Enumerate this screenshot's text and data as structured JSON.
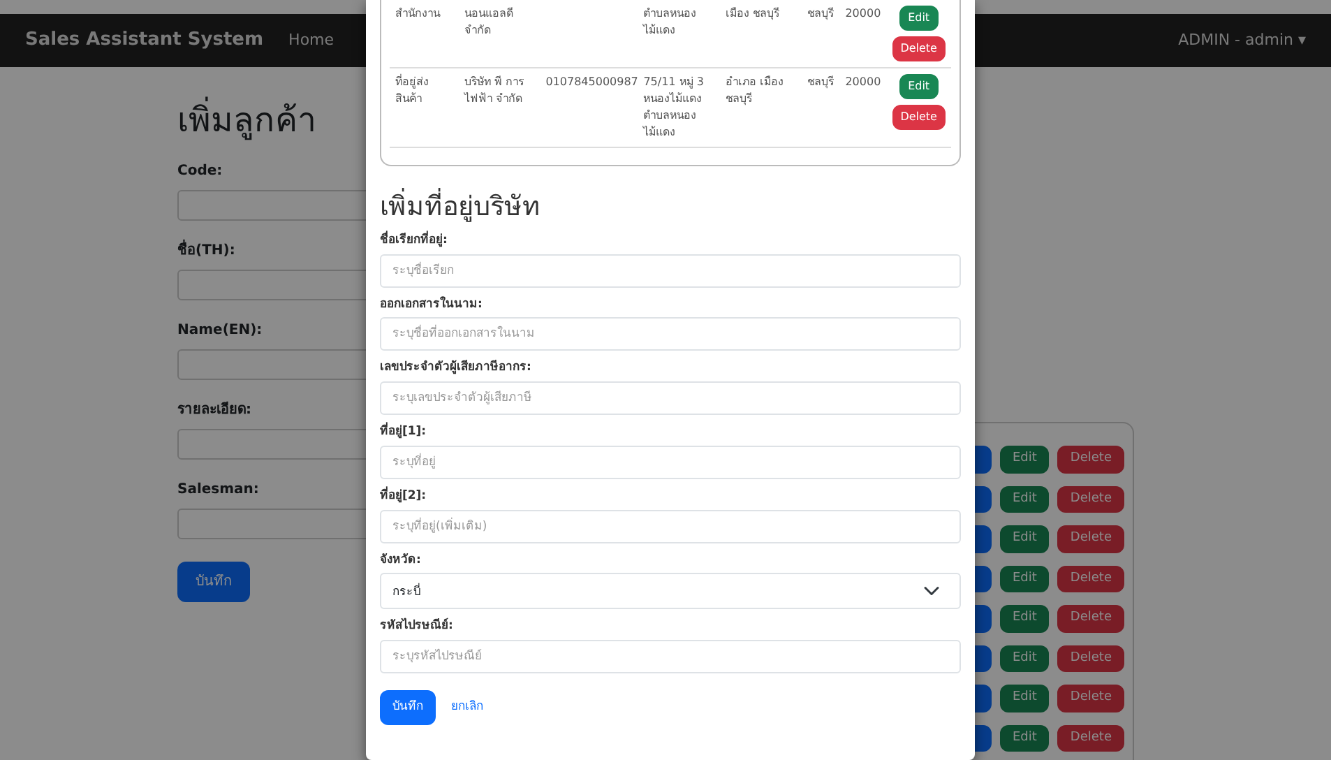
{
  "navbar": {
    "brand": "Sales Assistant System",
    "links": [
      "Home"
    ],
    "user": "ADMIN - admin ▾"
  },
  "customer_form": {
    "title": "เพิ่มลูกค้า",
    "fields": [
      {
        "label": "Code:"
      },
      {
        "label": "ชื่อ(TH):"
      },
      {
        "label": "Name(EN):"
      },
      {
        "label": "รายละเอียด:"
      },
      {
        "label": "Salesman:"
      }
    ],
    "submit": "บันทึก"
  },
  "customer_list": {
    "rows": [
      {
        "buttons": [
          {
            "kind": "primary"
          },
          {
            "kind": "edit",
            "label": "Edit"
          },
          {
            "kind": "delete",
            "label": "Delete"
          }
        ]
      },
      {
        "buttons": [
          {
            "kind": "primary"
          },
          {
            "kind": "edit",
            "label": "Edit"
          },
          {
            "kind": "delete",
            "label": "Delete"
          }
        ]
      },
      {
        "buttons": [
          {
            "kind": "primary"
          },
          {
            "kind": "edit",
            "label": "Edit"
          },
          {
            "kind": "delete",
            "label": "Delete"
          }
        ]
      },
      {
        "buttons": [
          {
            "kind": "primary"
          },
          {
            "kind": "edit",
            "label": "Edit"
          },
          {
            "kind": "delete",
            "label": "Delete"
          }
        ]
      },
      {
        "buttons": [
          {
            "kind": "primary"
          },
          {
            "kind": "edit",
            "label": "Edit"
          },
          {
            "kind": "delete",
            "label": "Delete"
          }
        ]
      },
      {
        "buttons": [
          {
            "kind": "primary"
          },
          {
            "kind": "edit",
            "label": "Edit"
          },
          {
            "kind": "delete",
            "label": "Delete"
          }
        ]
      },
      {
        "buttons": [
          {
            "kind": "primary"
          },
          {
            "kind": "edit",
            "label": "Edit"
          },
          {
            "kind": "delete",
            "label": "Delete"
          }
        ]
      },
      {
        "buttons": [
          {
            "kind": "primary"
          },
          {
            "kind": "edit",
            "label": "Edit"
          },
          {
            "kind": "delete",
            "label": "Delete"
          }
        ]
      }
    ]
  },
  "modal": {
    "address_table": {
      "rows": [
        {
          "cells": [
            "สำนักงาน",
            "นอนแอลดี จำกัด",
            "",
            "ตำบลหนองไม้แดง",
            "เมือง ชลบุรี",
            "ชลบุรี",
            "20000"
          ],
          "actions": [
            "Edit",
            "Delete"
          ]
        },
        {
          "cells": [
            "ที่อยู่ส่ง สินค้า",
            "บริษัท พี การไฟฟ้า จำกัด",
            "0107845000987",
            "75/11 หมู่ 3 หนองไม้แดง ตำบลหนองไม้แดง",
            "อำเภอ เมือง ชลบุรี",
            "ชลบุรี",
            "20000"
          ],
          "actions": [
            "Edit",
            "Delete"
          ]
        }
      ]
    },
    "form": {
      "title": "เพิ่มที่อยู่บริษัท",
      "fields": [
        {
          "kind": "input",
          "label": "ชื่อเรียกที่อยู่:",
          "placeholder": "ระบุชื่อเรียก"
        },
        {
          "kind": "input",
          "label": "ออกเอกสารในนาม:",
          "placeholder": "ระบุชื่อที่ออกเอกสารในนาม"
        },
        {
          "kind": "input",
          "label": "เลขประจำตัวผู้เสียภาษีอากร:",
          "placeholder": "ระบุเลขประจำตัวผู้เสียภาษี"
        },
        {
          "kind": "input",
          "label": "ที่อยู่[1]:",
          "placeholder": "ระบุที่อยู่"
        },
        {
          "kind": "input",
          "label": "ที่อยู่[2]:",
          "placeholder": "ระบุที่อยู่(เพิ่มเติม)"
        },
        {
          "kind": "select",
          "label": "จังหวัด:",
          "value": "กระบี่"
        },
        {
          "kind": "input",
          "label": "รหัสไปรษณีย์:",
          "placeholder": "ระบุรหัสไปรษณีย์"
        }
      ],
      "buttons": [
        {
          "kind": "primary",
          "label": "บันทึก"
        },
        {
          "kind": "link",
          "label": "ยกเลิก"
        }
      ]
    }
  }
}
